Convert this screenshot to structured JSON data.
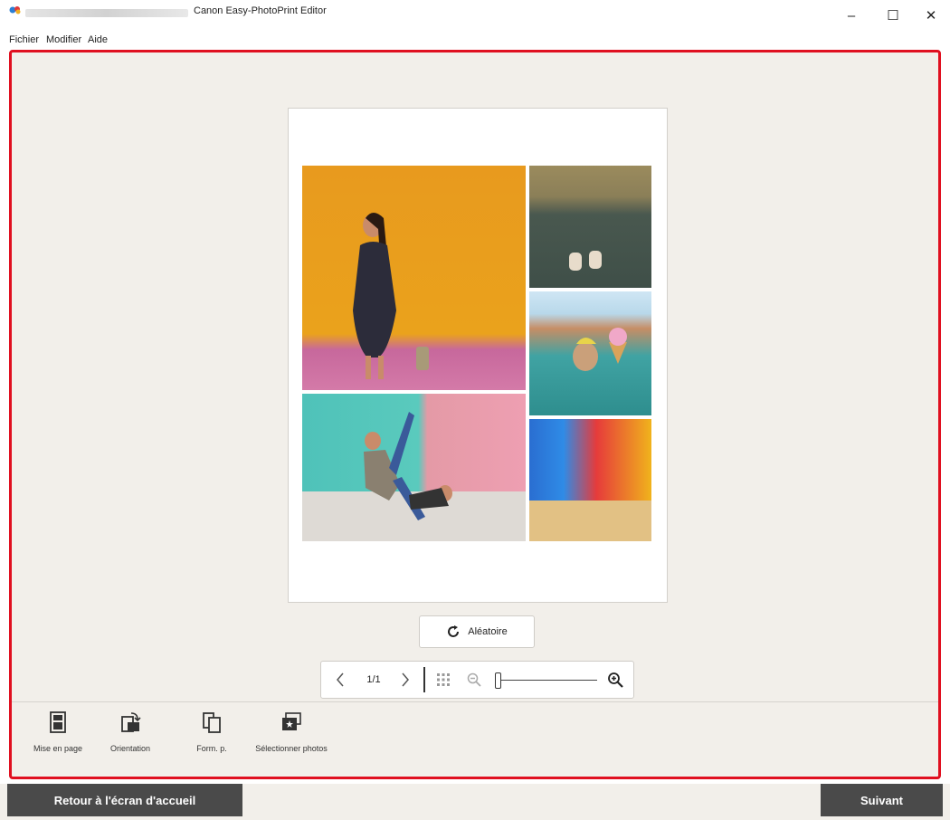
{
  "window": {
    "title": "Canon Easy-PhotoPrint Editor",
    "controls": {
      "minimize": "–",
      "maximize": "☐",
      "close": "✕"
    }
  },
  "menubar": {
    "items": [
      "Fichier",
      "Modifier",
      "Aide"
    ]
  },
  "editor": {
    "shuffle_label": "Aléatoire",
    "page_indicator": "1/1",
    "zoom_level": 0.0
  },
  "tools": [
    {
      "label": "Mise en page",
      "icon": "layout-icon"
    },
    {
      "label": "Orientation",
      "icon": "orientation-icon"
    },
    {
      "label": "Form. p.",
      "icon": "paper-size-icon"
    },
    {
      "label": "Sélectionner photos",
      "icon": "select-photos-icon"
    }
  ],
  "footer": {
    "home_label": "Retour à l'écran d'accueil",
    "next_label": "Suivant"
  },
  "colors": {
    "accent_border": "#e01020",
    "workspace_bg": "#f2efea",
    "footer_button": "#4a4a4a"
  }
}
